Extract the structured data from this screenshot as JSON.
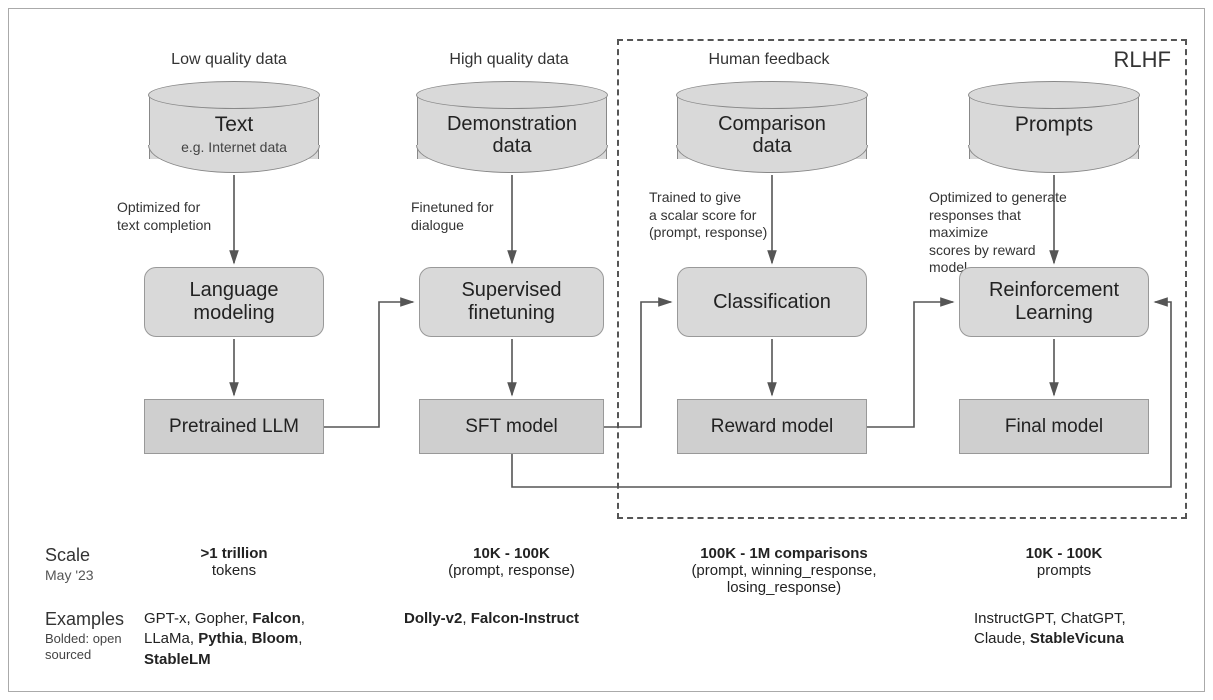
{
  "rlhf_label": "RLHF",
  "columns": {
    "c1": {
      "topcap": "Low quality data",
      "cyl_title": "Text",
      "cyl_sub": "e.g. Internet data",
      "arrow_label": "Optimized for\ntext completion",
      "proc": "Language\nmodeling",
      "out": "Pretrained LLM"
    },
    "c2": {
      "topcap": "High quality data",
      "cyl_title": "Demonstration\ndata",
      "arrow_label": "Finetuned for\ndialogue",
      "proc": "Supervised\nfinetuning",
      "out": "SFT model"
    },
    "c3": {
      "topcap": "Human feedback",
      "cyl_title": "Comparison\ndata",
      "arrow_label": "Trained to give\na scalar score for\n(prompt, response)",
      "proc": "Classification",
      "out": "Reward model"
    },
    "c4": {
      "cyl_title": "Prompts",
      "arrow_label": "Optimized to generate\nresponses that maximize\nscores by reward model",
      "proc": "Reinforcement\nLearning",
      "out": "Final model"
    }
  },
  "scale": {
    "label": "Scale",
    "date": "May '23",
    "c1_main": ">1 trillion",
    "c1_sub": "tokens",
    "c2_main": "10K - 100K",
    "c2_sub": "(prompt, response)",
    "c3_main": "100K - 1M comparisons",
    "c3_sub": "(prompt, winning_response, losing_response)",
    "c4_main": "10K - 100K",
    "c4_sub": "prompts"
  },
  "examples": {
    "label": "Examples",
    "note": "Bolded: open\nsourced",
    "c1_html": "GPT-x, Gopher, <b>Falcon</b>,<br>LLaMa, <b>Pythia</b>, <b>Bloom</b>,<br><b>StableLM</b>",
    "c2_html": "<b>Dolly-v2</b>, <b>Falcon-Instruct</b>",
    "c4_html": "InstructGPT, ChatGPT,<br>Claude, <b>StableVicuna</b>"
  }
}
